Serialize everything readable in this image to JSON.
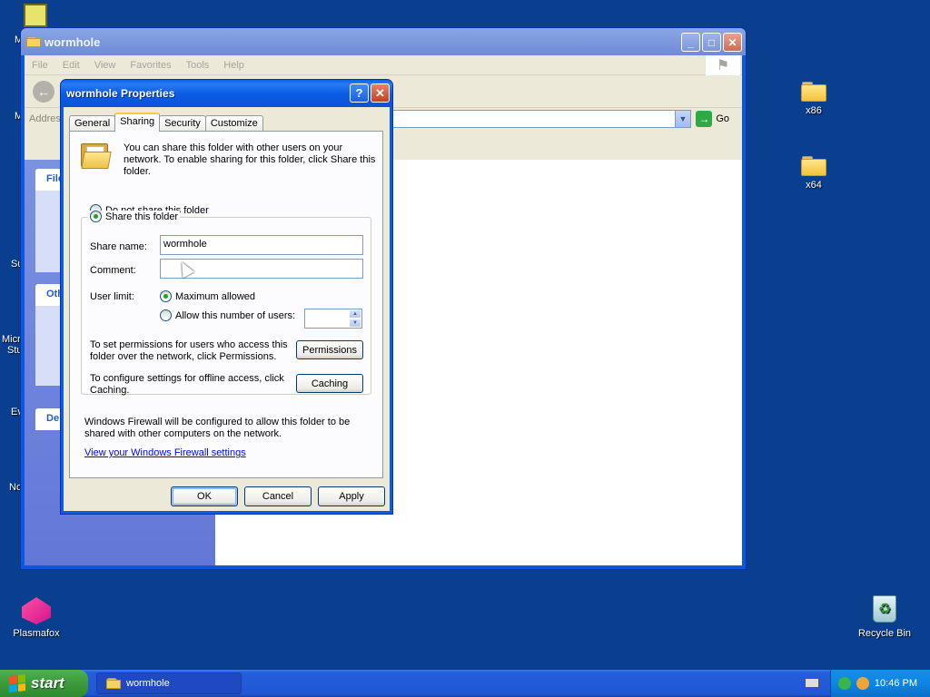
{
  "desktop": {
    "icons": [
      {
        "label": "x86"
      },
      {
        "label": "x64"
      },
      {
        "label": "Plasmafox"
      },
      {
        "label": "Recycle Bin"
      }
    ],
    "edge_labels": [
      "M",
      "M",
      "Su",
      "Micro",
      "Stu",
      "Ev",
      "No"
    ]
  },
  "explorer": {
    "title": "wormhole",
    "menu": [
      "File",
      "Edit",
      "View",
      "Favorites",
      "Tools",
      "Help"
    ],
    "address_label": "Address",
    "go_label": "Go",
    "left_pane": [
      "File",
      "Oth",
      "De"
    ]
  },
  "dialog": {
    "title": "wormhole Properties",
    "help_button": "?",
    "tabs": [
      "General",
      "Sharing",
      "Security",
      "Customize"
    ],
    "active_tab": "Sharing",
    "intro": "You can share this folder with other users on your network.  To enable sharing for this folder, click Share this folder.",
    "do_not_share": "Do not share this folder",
    "share_this": "Share this folder",
    "share_name_label": "Share name:",
    "share_name_value": "wormhole",
    "comment_label": "Comment:",
    "comment_value": "",
    "user_limit_label": "User limit:",
    "max_allowed": "Maximum allowed",
    "allow_number": "Allow this number of users:",
    "permissions_text": "To set permissions for users who access this folder over the network, click Permissions.",
    "permissions_button": "Permissions",
    "caching_text": "To configure settings for offline access, click Caching.",
    "caching_button": "Caching",
    "firewall_text": "Windows Firewall will be configured to allow this folder to be shared with other computers on the network.",
    "firewall_link": "View your Windows Firewall settings",
    "ok": "OK",
    "cancel": "Cancel",
    "apply": "Apply"
  },
  "taskbar": {
    "start": "start",
    "task": "wormhole",
    "clock": "10:46 PM"
  }
}
